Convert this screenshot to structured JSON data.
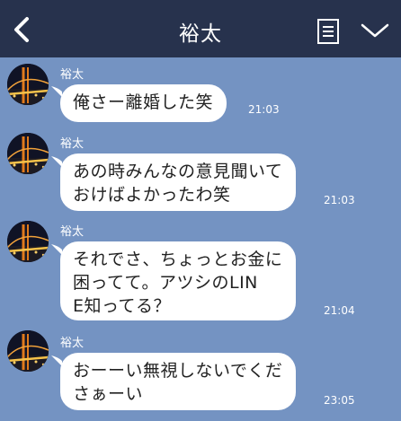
{
  "header": {
    "title": "裕太",
    "back_icon": "chevron-left-icon",
    "notes_icon": "notes-icon",
    "menu_icon": "chevron-down-icon"
  },
  "messages": [
    {
      "sender": "裕太",
      "lines": [
        "俺さー離婚した笑"
      ],
      "time": "21:03"
    },
    {
      "sender": "裕太",
      "lines": [
        "あの時みんなの意見聞いて",
        "おけばよかったわ笑"
      ],
      "time": "21:03"
    },
    {
      "sender": "裕太",
      "lines": [
        "それでさ、ちょっとお金に",
        "困ってて。アツシのLIN",
        "E知ってる？"
      ],
      "time": "21:04"
    },
    {
      "sender": "裕太",
      "lines": [
        "おーーい無視しないでくだ",
        "さぁーい"
      ],
      "time": "23:05"
    }
  ],
  "colors": {
    "header_bg": "#27324d",
    "chat_bg": "#7493c2",
    "bubble": "#ffffff"
  }
}
